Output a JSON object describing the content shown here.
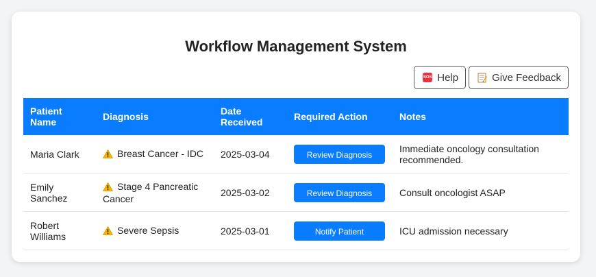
{
  "page": {
    "title": "Workflow Management System"
  },
  "toolbar": {
    "help_label": "Help",
    "feedback_label": "Give Feedback",
    "help_icon": "sos-icon",
    "feedback_icon": "memo-icon"
  },
  "table": {
    "headers": [
      "Patient Name",
      "Diagnosis",
      "Date Received",
      "Required Action",
      "Notes"
    ],
    "rows": [
      {
        "patient": "Maria Clark",
        "diagnosis": "Breast Cancer - IDC",
        "date": "2025-03-04",
        "action": "Review Diagnosis",
        "notes": "Immediate oncology consultation recommended."
      },
      {
        "patient": "Emily Sanchez",
        "diagnosis": "Stage 4 Pancreatic Cancer",
        "date": "2025-03-02",
        "action": "Review Diagnosis",
        "notes": "Consult oncologist ASAP"
      },
      {
        "patient": "Robert Williams",
        "diagnosis": "Severe Sepsis",
        "date": "2025-03-01",
        "action": "Notify Patient",
        "notes": "ICU admission necessary"
      }
    ]
  },
  "colors": {
    "accent": "#0a7cff",
    "warning": "#f5b400",
    "sos": "#e8313f"
  }
}
